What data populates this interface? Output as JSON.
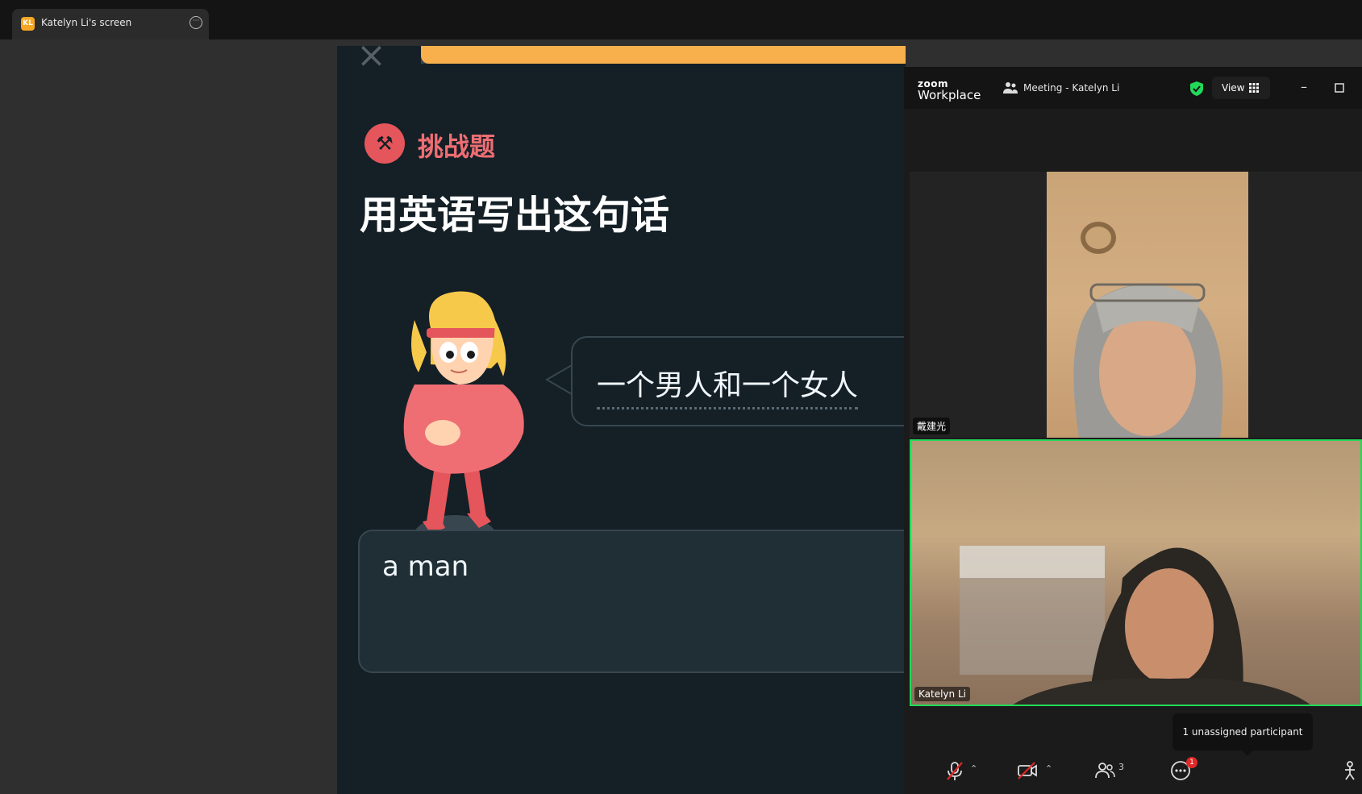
{
  "share_bar": {
    "initials": "KL",
    "title": "Katelyn Li's screen"
  },
  "shared_screen": {
    "progress": 0.99,
    "challenge_label": "挑战题",
    "prompt": "用英语写出这句话",
    "sentence": "一个男人和一个女人",
    "answer": "a man"
  },
  "zoom": {
    "logo_small": "zoom",
    "logo_big": "Workplace",
    "meeting_title": "Meeting - Katelyn Li",
    "view_label": "View",
    "participants": [
      {
        "name": "戴建光"
      },
      {
        "name": "Katelyn Li"
      }
    ],
    "tooltip": "1 unassigned participant",
    "toolbar": {
      "participants_count": "3",
      "more_badge": "1"
    },
    "colors": {
      "active_speaker": "#23d959",
      "header": "#141414"
    }
  }
}
